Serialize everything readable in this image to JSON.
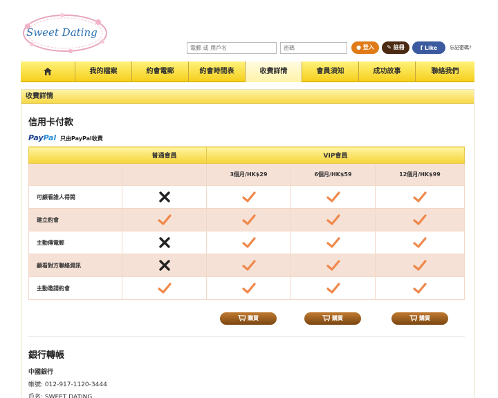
{
  "logo": {
    "text": "Sweet Dating"
  },
  "header": {
    "username_placeholder": "電郵 或 用戶名",
    "password_placeholder": "密碼",
    "login_label": "登入",
    "register_label": "註冊",
    "facebook_label": "Like",
    "forgot_label": "忘記密碼?"
  },
  "nav": {
    "items": [
      {
        "label": "我的檔案"
      },
      {
        "label": "約會電郵"
      },
      {
        "label": "約會時間表"
      },
      {
        "label": "收費詳情"
      },
      {
        "label": "會員須知"
      },
      {
        "label": "成功故事"
      },
      {
        "label": "聯絡我們"
      }
    ],
    "active_index": 3
  },
  "page": {
    "section_title": "收費詳情",
    "credit_heading": "信用卡付款",
    "paypal_brand_1": "Pay",
    "paypal_brand_2": "Pal",
    "paypal_note": "只由PayPal收費",
    "bank_heading": "銀行轉帳"
  },
  "pricing": {
    "group_basic": "普通會員",
    "group_vip": "VIP會員",
    "plans": [
      "3個月/HK$29",
      "6個月/HK$59",
      "12個月/HK$99"
    ],
    "features": [
      {
        "label": "可顧看誰人得閱",
        "basic": false
      },
      {
        "label": "建立約會",
        "basic": true
      },
      {
        "label": "主動傳電郵",
        "basic": false
      },
      {
        "label": "顧看對方聯絡資訊",
        "basic": false
      },
      {
        "label": "主動邀請約會",
        "basic": true
      }
    ],
    "buy_label": "購買",
    "check_color": "#f0884a",
    "cross_color": "#222222"
  },
  "bank": {
    "name": "中國銀行",
    "account": "帳號: 012-917-1120-3444",
    "holder": "戶名: SWEET DATING"
  }
}
